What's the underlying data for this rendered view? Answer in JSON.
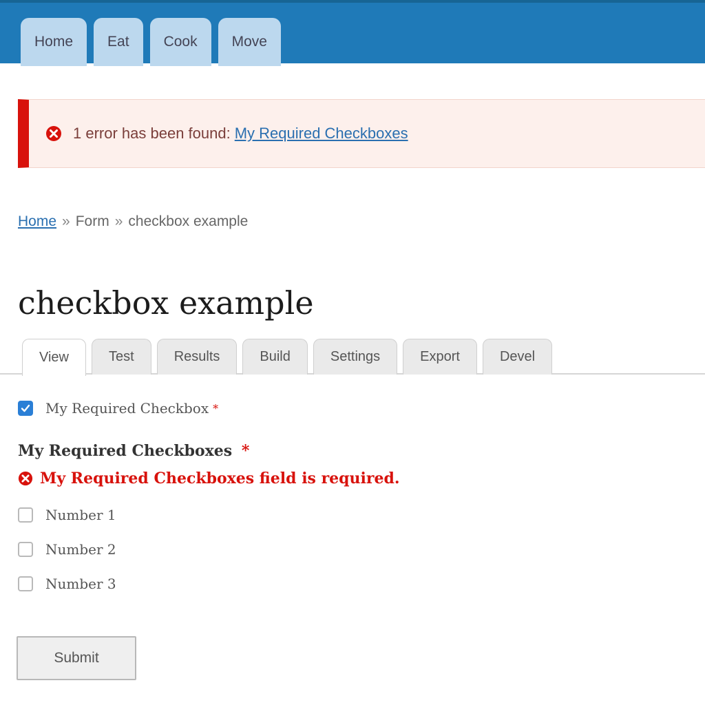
{
  "nav": {
    "items": [
      {
        "label": "Home"
      },
      {
        "label": "Eat"
      },
      {
        "label": "Cook"
      },
      {
        "label": "Move"
      }
    ]
  },
  "message": {
    "text": "1 error has been found:",
    "link": "My Required Checkboxes"
  },
  "breadcrumb": {
    "items": [
      "Home",
      "Form",
      "checkbox example"
    ],
    "separator": "»"
  },
  "page": {
    "title": "checkbox example"
  },
  "tabs": {
    "items": [
      {
        "label": "View"
      },
      {
        "label": "Test"
      },
      {
        "label": "Results"
      },
      {
        "label": "Build"
      },
      {
        "label": "Settings"
      },
      {
        "label": "Export"
      },
      {
        "label": "Devel"
      }
    ],
    "active": "View"
  },
  "form": {
    "required_checkbox": {
      "label": "My Required Checkbox",
      "checked": true,
      "required_marker": "*"
    },
    "checkboxes": {
      "legend": "My Required Checkboxes",
      "required_marker": "*",
      "error": "My Required Checkboxes field is required.",
      "options": [
        {
          "label": "Number 1",
          "checked": false
        },
        {
          "label": "Number 2",
          "checked": false
        },
        {
          "label": "Number 3",
          "checked": false
        }
      ]
    },
    "submit_label": "Submit"
  },
  "colors": {
    "header": "#1f7ab8",
    "nav_tab": "#bcd8ee",
    "error": "#d8120c",
    "link": "#2a6fb0",
    "checkbox_checked": "#2a7fd6"
  }
}
